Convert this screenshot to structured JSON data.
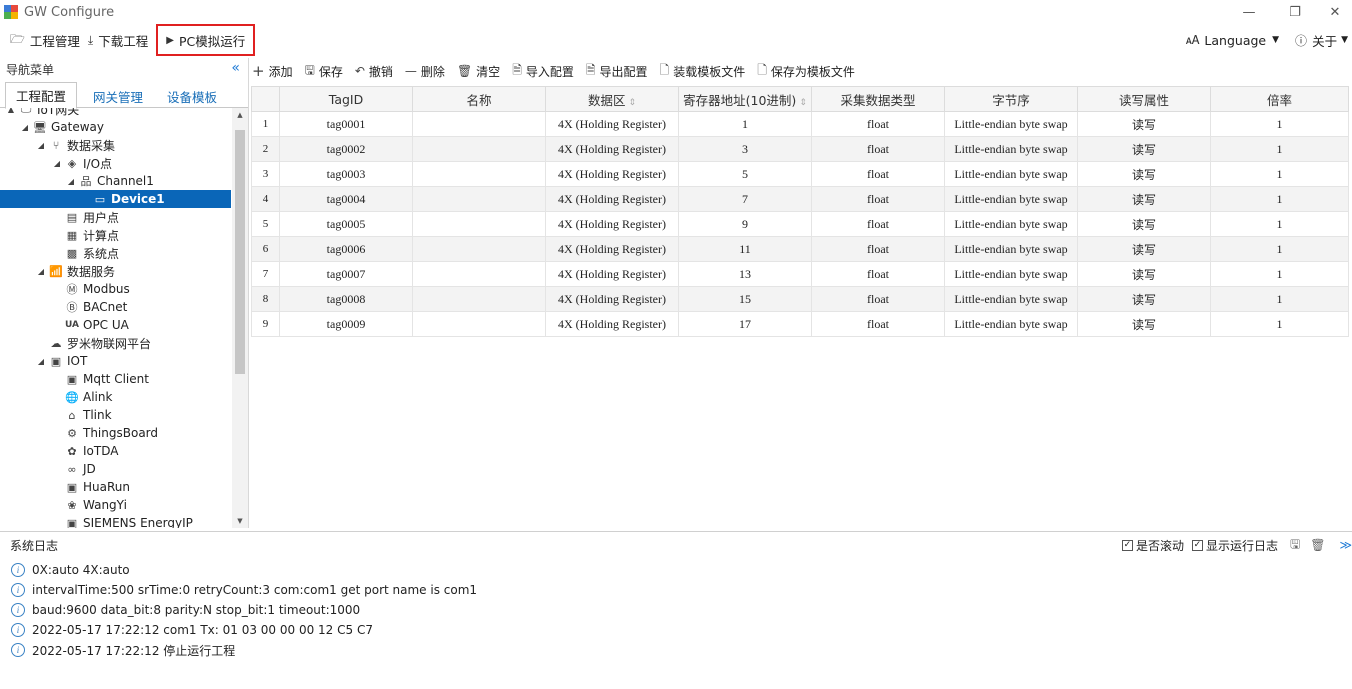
{
  "window": {
    "title": "GW Configure",
    "minimize": "—",
    "restore": "❐",
    "close": "✕"
  },
  "menu": {
    "project": "工程管理",
    "download": "下载工程",
    "simulate": "PC模拟运行",
    "language": "Language",
    "about": "关于"
  },
  "nav": {
    "title": "导航菜单",
    "tabs": [
      "工程配置",
      "网关管理",
      "设备模板"
    ],
    "tree": [
      {
        "label": "IoT网关",
        "level": 0,
        "arrow": "▲",
        "icon": "computer-icon"
      },
      {
        "label": "Gateway",
        "level": 1,
        "arrow": "◢",
        "icon": "monitor-icon"
      },
      {
        "label": "数据采集",
        "level": 2,
        "arrow": "◢",
        "icon": "fork-icon"
      },
      {
        "label": "I/O点",
        "level": 3,
        "arrow": "◢",
        "icon": "tag-icon"
      },
      {
        "label": "Channel1",
        "level": 4,
        "arrow": "◢",
        "icon": "network-icon"
      },
      {
        "label": "Device1",
        "level": 5,
        "arrow": "",
        "icon": "device-icon",
        "selected": true
      },
      {
        "label": "用户点",
        "level": 3,
        "arrow": "",
        "icon": "user-point-icon"
      },
      {
        "label": "计算点",
        "level": 3,
        "arrow": "",
        "icon": "calc-point-icon"
      },
      {
        "label": "系统点",
        "level": 3,
        "arrow": "",
        "icon": "system-point-icon"
      },
      {
        "label": "数据服务",
        "level": 2,
        "arrow": "◢",
        "icon": "chart-icon"
      },
      {
        "label": "Modbus",
        "level": 3,
        "arrow": "",
        "icon": "modbus-icon"
      },
      {
        "label": "BACnet",
        "level": 3,
        "arrow": "",
        "icon": "bacnet-icon"
      },
      {
        "label": "OPC UA",
        "level": 3,
        "arrow": "",
        "icon": "opcua-icon"
      },
      {
        "label": "罗米物联网平台",
        "level": 2,
        "arrow": "",
        "icon": "cloud-upload-icon"
      },
      {
        "label": "IOT",
        "level": 2,
        "arrow": "◢",
        "icon": "iot-icon"
      },
      {
        "label": "Mqtt Client",
        "level": 3,
        "arrow": "",
        "icon": "mqtt-icon"
      },
      {
        "label": "Alink",
        "level": 3,
        "arrow": "",
        "icon": "globe-icon"
      },
      {
        "label": "Tlink",
        "level": 3,
        "arrow": "",
        "icon": "tlink-icon"
      },
      {
        "label": "ThingsBoard",
        "level": 3,
        "arrow": "",
        "icon": "gear-icon"
      },
      {
        "label": "IoTDA",
        "level": 3,
        "arrow": "",
        "icon": "huawei-icon"
      },
      {
        "label": "JD",
        "level": 3,
        "arrow": "",
        "icon": "jd-icon"
      },
      {
        "label": "HuaRun",
        "level": 3,
        "arrow": "",
        "icon": "huarun-icon"
      },
      {
        "label": "WangYi",
        "level": 3,
        "arrow": "",
        "icon": "wangyi-icon"
      },
      {
        "label": "SIEMENS EnergyIP",
        "level": 3,
        "arrow": "",
        "icon": "siemens-icon"
      }
    ]
  },
  "toolbar": {
    "add": "添加",
    "save": "保存",
    "undo": "撤销",
    "delete": "删除",
    "clear": "清空",
    "import": "导入配置",
    "export": "导出配置",
    "load_template": "装载模板文件",
    "save_template": "保存为模板文件"
  },
  "table": {
    "columns": [
      "",
      "TagID",
      "名称",
      "数据区",
      "寄存器地址(10进制)",
      "采集数据类型",
      "字节序",
      "读写属性",
      "倍率"
    ],
    "rows": [
      [
        "1",
        "tag0001",
        "",
        "4X (Holding Register)",
        "1",
        "float",
        "Little-endian byte swap",
        "读写",
        "1"
      ],
      [
        "2",
        "tag0002",
        "",
        "4X (Holding Register)",
        "3",
        "float",
        "Little-endian byte swap",
        "读写",
        "1"
      ],
      [
        "3",
        "tag0003",
        "",
        "4X (Holding Register)",
        "5",
        "float",
        "Little-endian byte swap",
        "读写",
        "1"
      ],
      [
        "4",
        "tag0004",
        "",
        "4X (Holding Register)",
        "7",
        "float",
        "Little-endian byte swap",
        "读写",
        "1"
      ],
      [
        "5",
        "tag0005",
        "",
        "4X (Holding Register)",
        "9",
        "float",
        "Little-endian byte swap",
        "读写",
        "1"
      ],
      [
        "6",
        "tag0006",
        "",
        "4X (Holding Register)",
        "11",
        "float",
        "Little-endian byte swap",
        "读写",
        "1"
      ],
      [
        "7",
        "tag0007",
        "",
        "4X (Holding Register)",
        "13",
        "float",
        "Little-endian byte swap",
        "读写",
        "1"
      ],
      [
        "8",
        "tag0008",
        "",
        "4X (Holding Register)",
        "15",
        "float",
        "Little-endian byte swap",
        "读写",
        "1"
      ],
      [
        "9",
        "tag0009",
        "",
        "4X (Holding Register)",
        "17",
        "float",
        "Little-endian byte swap",
        "读写",
        "1"
      ]
    ]
  },
  "log": {
    "title": "系统日志",
    "autoscroll": "是否滚动",
    "show_runlog": "显示运行日志",
    "lines": [
      "0X:auto 4X:auto",
      "intervalTime:500 srTime:0 retryCount:3 com:com1 get port name is com1",
      "baud:9600 data_bit:8 parity:N stop_bit:1 timeout:1000",
      "2022-05-17 17:22:12 com1 Tx: 01 03 00 00 00 12 C5 C7",
      "2022-05-17 17:22:12 停止运行工程"
    ]
  },
  "colors": {
    "accent": "#0a66b8",
    "highlight_border": "#e02020",
    "tab_link": "#1a6fb8"
  }
}
